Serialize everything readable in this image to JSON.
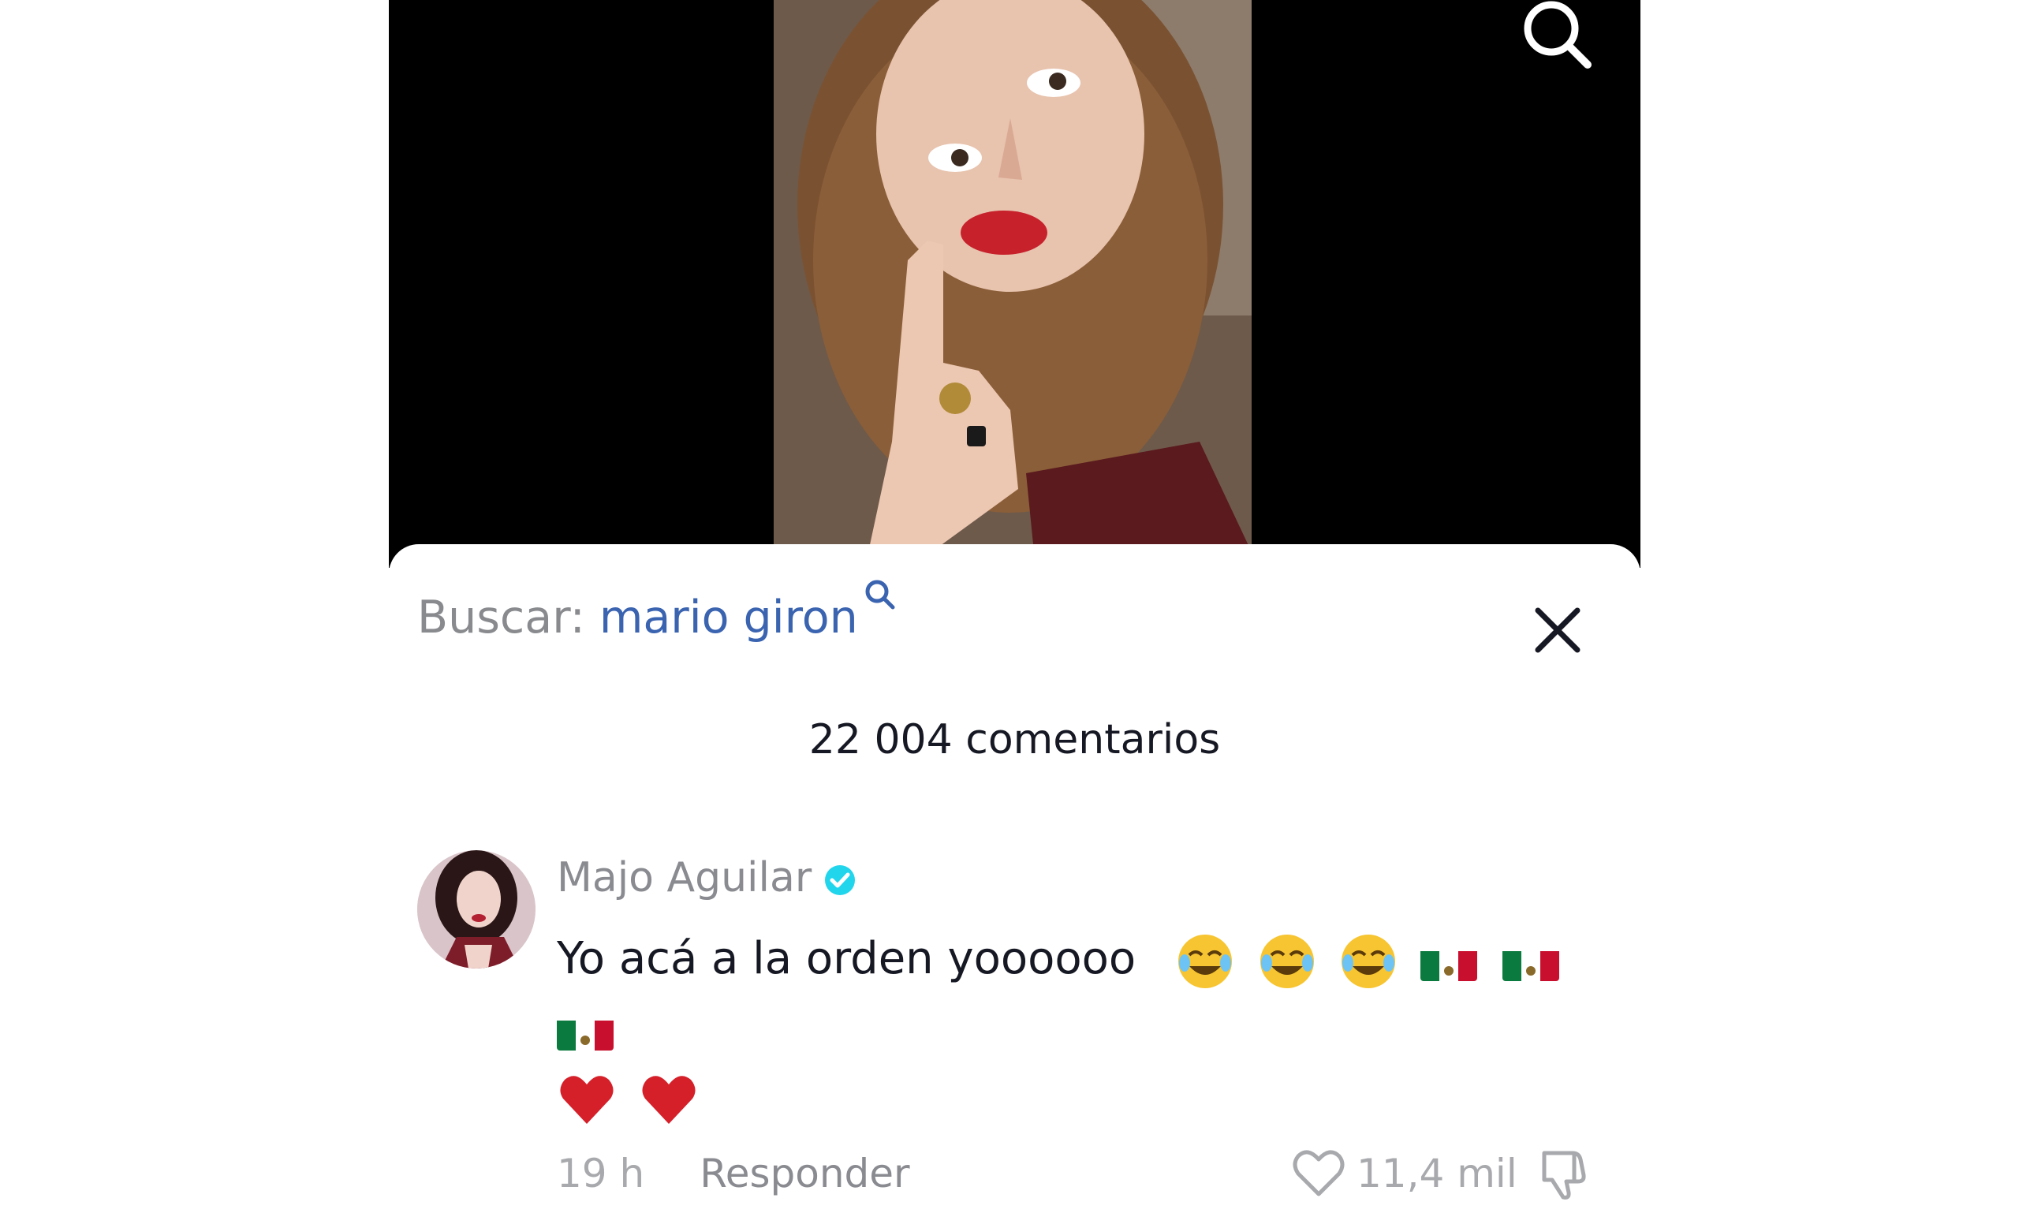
{
  "search": {
    "label": "Buscar:",
    "query": "mario giron"
  },
  "comments_header": {
    "count_label": "22 004 comentarios"
  },
  "comment": {
    "username": "Majo Aguilar",
    "verified": true,
    "text": "Yo acá a la orden yoooooo",
    "emojis": [
      "face-with-tears-of-joy",
      "face-with-tears-of-joy",
      "face-with-tears-of-joy",
      "mexico-flag",
      "mexico-flag",
      "mexico-flag",
      "red-heart",
      "red-heart"
    ],
    "time": "19 h",
    "reply_label": "Responder",
    "likes": "11,4 mil"
  },
  "colors": {
    "accent_link": "#3a63b0",
    "verified_badge": "#20d5ec",
    "text_primary": "#161823",
    "text_secondary": "#8a8b91"
  },
  "icons": [
    "search-icon",
    "close-icon",
    "verified-icon",
    "heart-icon",
    "dislike-icon"
  ]
}
